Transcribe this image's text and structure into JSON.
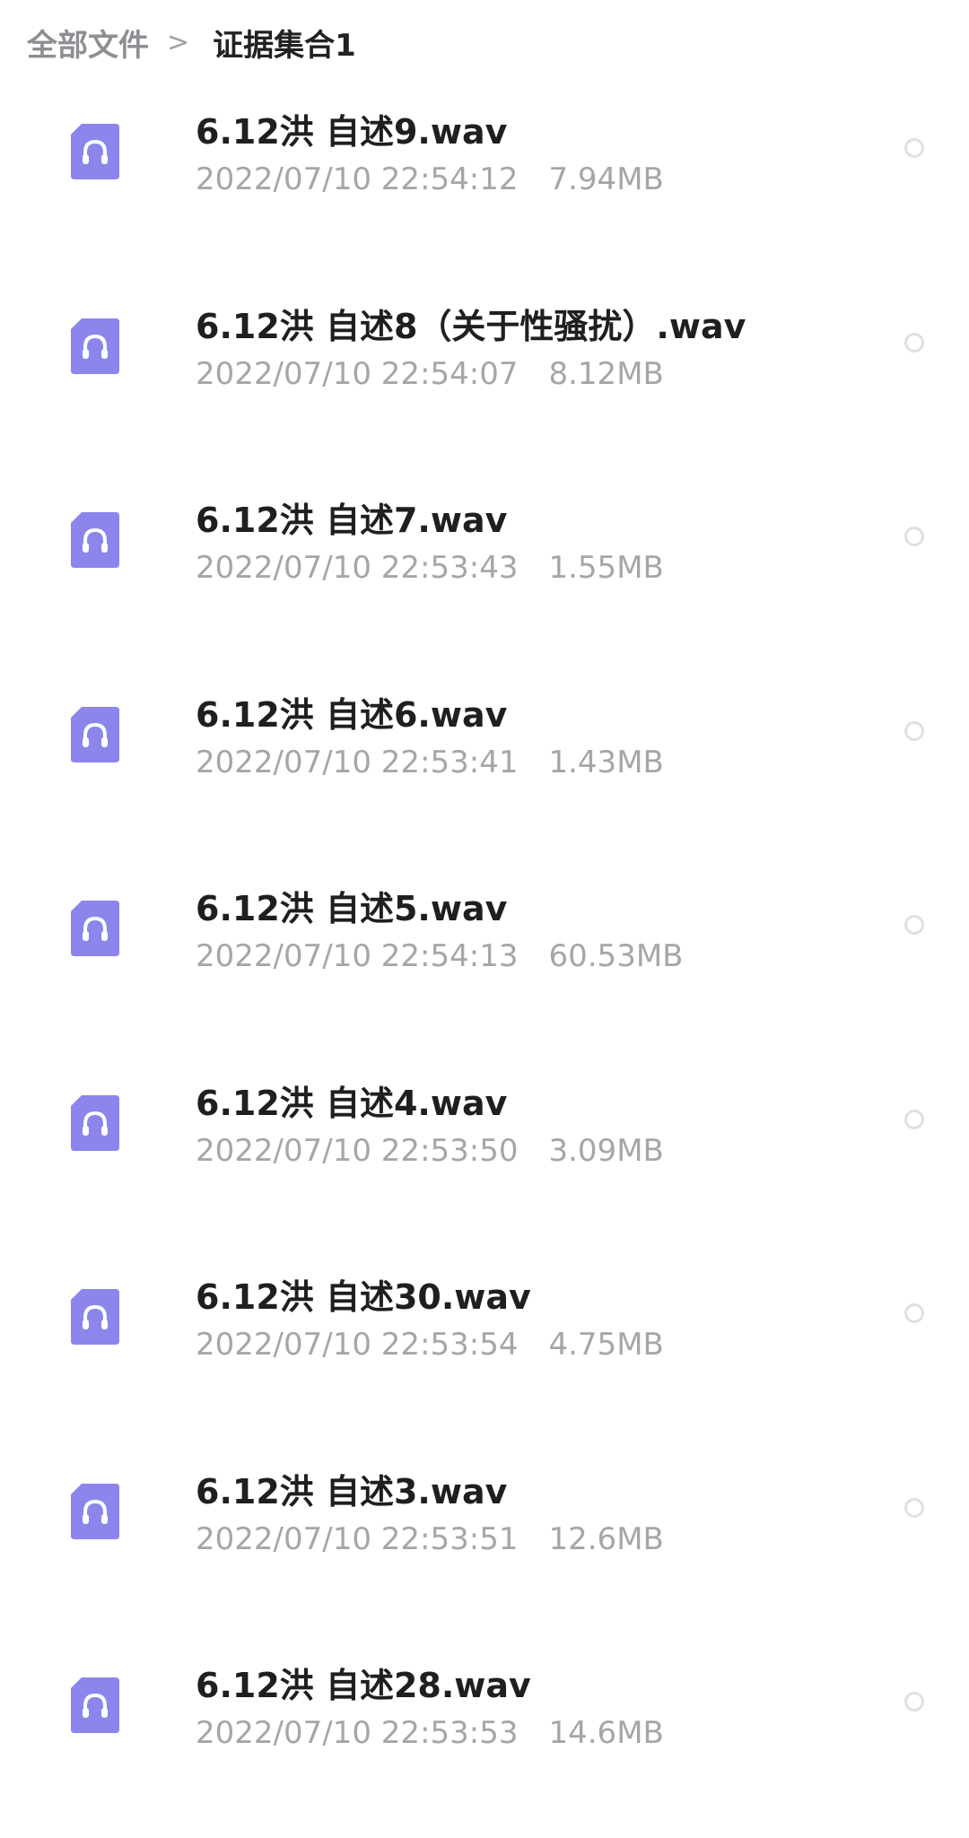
{
  "breadcrumb": {
    "root": "全部文件",
    "separator": ">",
    "current": "证据集合1"
  },
  "icon": {
    "name": "headphones-audio-file-icon",
    "color": "#8b85ec",
    "color_light": "#aaa5f5"
  },
  "files": [
    {
      "name": "6.12洪  自述9.wav",
      "date": "2022/07/10 22:54:12",
      "size": "7.94MB"
    },
    {
      "name": "6.12洪  自述8（关于性骚扰）.wav",
      "date": "2022/07/10 22:54:07",
      "size": "8.12MB"
    },
    {
      "name": "6.12洪  自述7.wav",
      "date": "2022/07/10 22:53:43",
      "size": "1.55MB"
    },
    {
      "name": "6.12洪  自述6.wav",
      "date": "2022/07/10 22:53:41",
      "size": "1.43MB"
    },
    {
      "name": "6.12洪  自述5.wav",
      "date": "2022/07/10 22:54:13",
      "size": "60.53MB"
    },
    {
      "name": "6.12洪  自述4.wav",
      "date": "2022/07/10 22:53:50",
      "size": "3.09MB"
    },
    {
      "name": "6.12洪  自述30.wav",
      "date": "2022/07/10 22:53:54",
      "size": "4.75MB"
    },
    {
      "name": "6.12洪  自述3.wav",
      "date": "2022/07/10 22:53:51",
      "size": "12.6MB"
    },
    {
      "name": "6.12洪  自述28.wav",
      "date": "2022/07/10 22:53:53",
      "size": "14.6MB"
    }
  ]
}
